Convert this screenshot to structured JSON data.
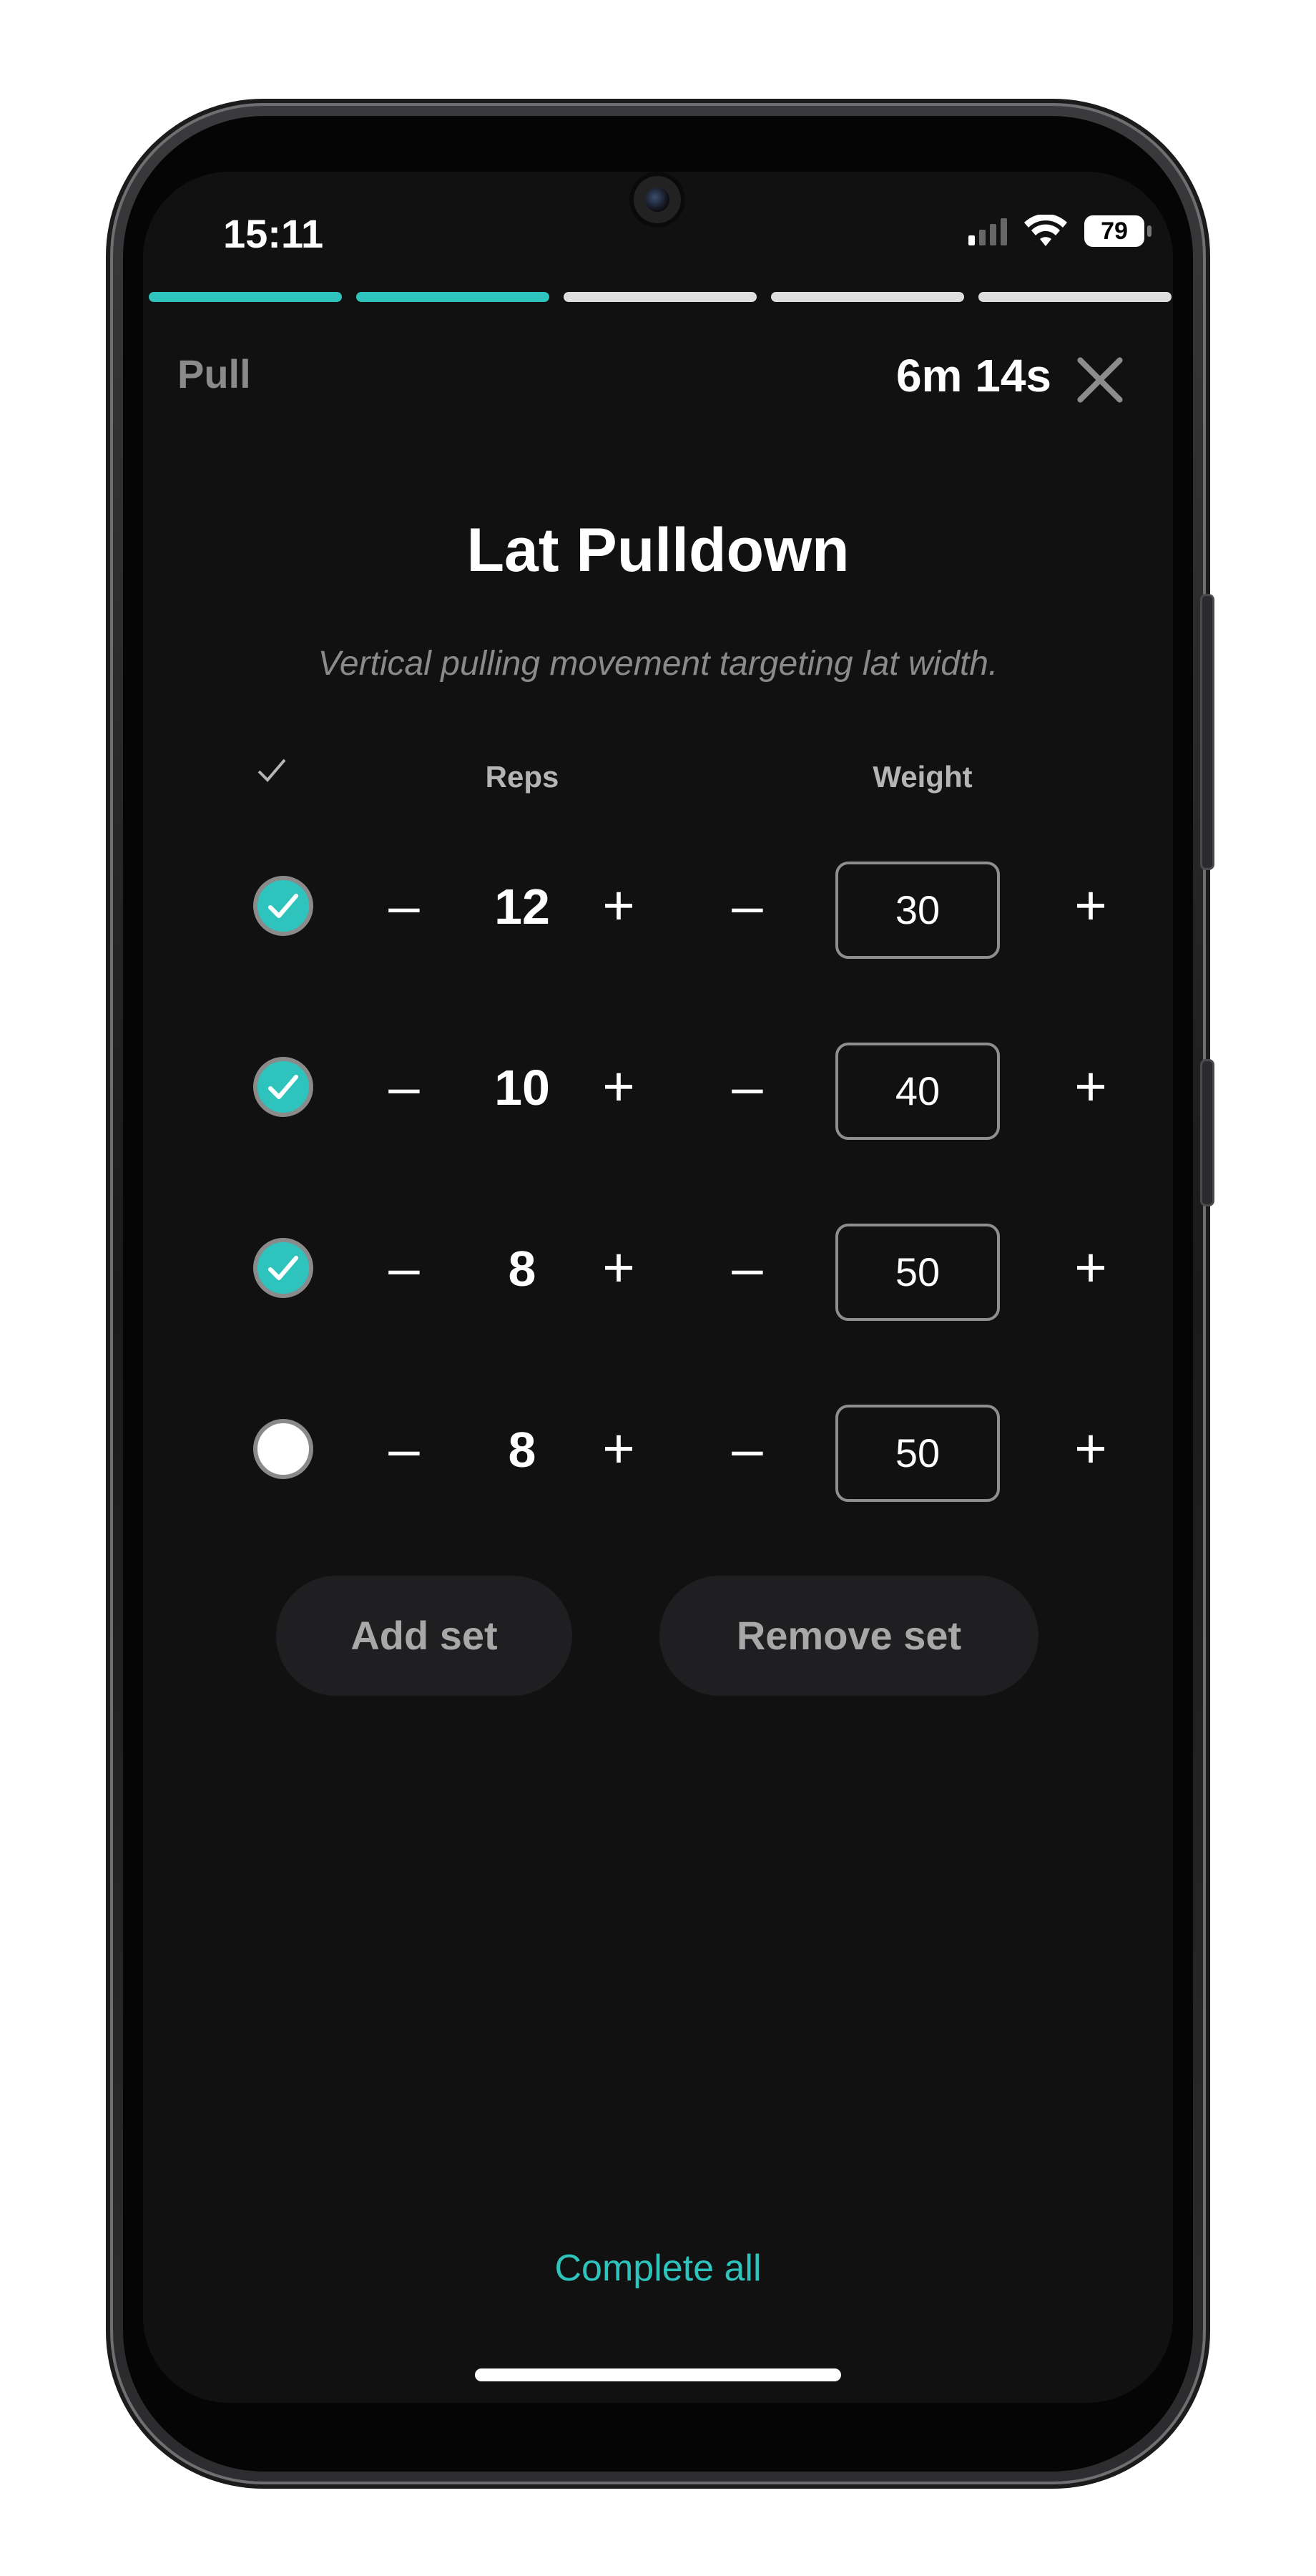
{
  "status_bar": {
    "time": "15:11",
    "battery": "79",
    "icons": [
      "signal-icon",
      "wifi-icon",
      "battery-icon"
    ]
  },
  "progress": {
    "segments_total": 5,
    "segments_done": 2,
    "accent_color": "#2ec4bd"
  },
  "header": {
    "workout_name": "Pull",
    "timer": "6m 14s",
    "close_icon": "close-icon"
  },
  "exercise": {
    "title": "Lat Pulldown",
    "description": "Vertical pulling movement targeting lat width."
  },
  "table": {
    "check_header": "✓",
    "reps_header": "Reps",
    "weight_header": "Weight",
    "minus_label": "–",
    "plus_label": "+",
    "sets": [
      {
        "done": true,
        "reps": "12",
        "weight": "30"
      },
      {
        "done": true,
        "reps": "10",
        "weight": "40"
      },
      {
        "done": true,
        "reps": "8",
        "weight": "50"
      },
      {
        "done": false,
        "reps": "8",
        "weight": "50"
      }
    ]
  },
  "buttons": {
    "add_set": "Add set",
    "remove_set": "Remove set",
    "complete_all": "Complete all"
  },
  "colors": {
    "background": "#111111",
    "accent": "#2ec4bd",
    "muted_text": "#8a8a8a",
    "button_bg": "#1f1f21"
  }
}
